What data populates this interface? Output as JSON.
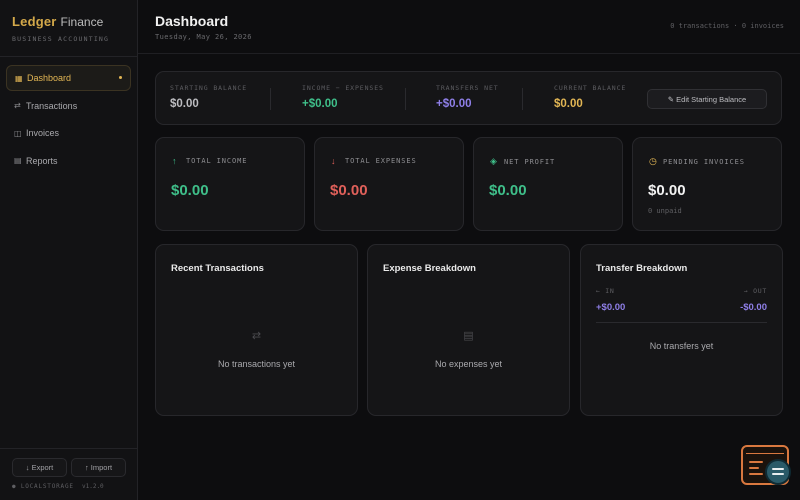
{
  "sidebar": {
    "brand": {
      "name": "Ledger",
      "suffix": "Finance",
      "tagline": "BUSINESS ACCOUNTING"
    },
    "items": [
      {
        "icon": "▦",
        "label": "Dashboard",
        "active": true
      },
      {
        "icon": "⇄",
        "label": "Transactions"
      },
      {
        "icon": "◫",
        "label": "Invoices"
      },
      {
        "icon": "▤",
        "label": "Reports"
      }
    ],
    "export_label": "↓ Export",
    "import_label": "↑ Import",
    "storage": "● LOCALSTORAGE",
    "version": "v1.2.0"
  },
  "header": {
    "title": "Dashboard",
    "date": "Tuesday, May 26, 2026",
    "stats": "0 transactions · 0 invoices"
  },
  "balance": {
    "starting": {
      "label": "STARTING BALANCE",
      "value": "$0.00"
    },
    "income_expenses": {
      "label": "INCOME − EXPENSES",
      "value": "+$0.00"
    },
    "transfers": {
      "label": "TRANSFERS NET",
      "value": "+$0.00"
    },
    "current": {
      "label": "CURRENT BALANCE",
      "value": "$0.00"
    },
    "edit_label": "✎ Edit Starting Balance"
  },
  "stats": [
    {
      "icon": "↑",
      "label": "TOTAL INCOME",
      "value": "$0.00",
      "color": "#3fbf8a"
    },
    {
      "icon": "↓",
      "label": "TOTAL EXPENSES",
      "value": "$0.00",
      "color": "#e0605a"
    },
    {
      "icon": "◈",
      "label": "NET PROFIT",
      "value": "$0.00",
      "color": "#3fbf8a"
    },
    {
      "icon": "◷",
      "label": "PENDING INVOICES",
      "value": "$0.00",
      "sub": "0 unpaid",
      "color": "#f2f2f2"
    }
  ],
  "panels": {
    "recent": {
      "title": "Recent Transactions",
      "icon": "⇄",
      "empty": "No transactions yet"
    },
    "expense": {
      "title": "Expense Breakdown",
      "icon": "▤",
      "empty": "No expenses yet"
    },
    "transfer": {
      "title": "Transfer Breakdown",
      "in_label": "← IN",
      "in_value": "+$0.00",
      "out_label": "→ OUT",
      "out_value": "-$0.00",
      "empty": "No transfers yet"
    }
  },
  "colors": {
    "accent": "#e2b654",
    "income": "#3fbf8a",
    "expense": "#e0605a",
    "transfer": "#8f7fe8"
  }
}
